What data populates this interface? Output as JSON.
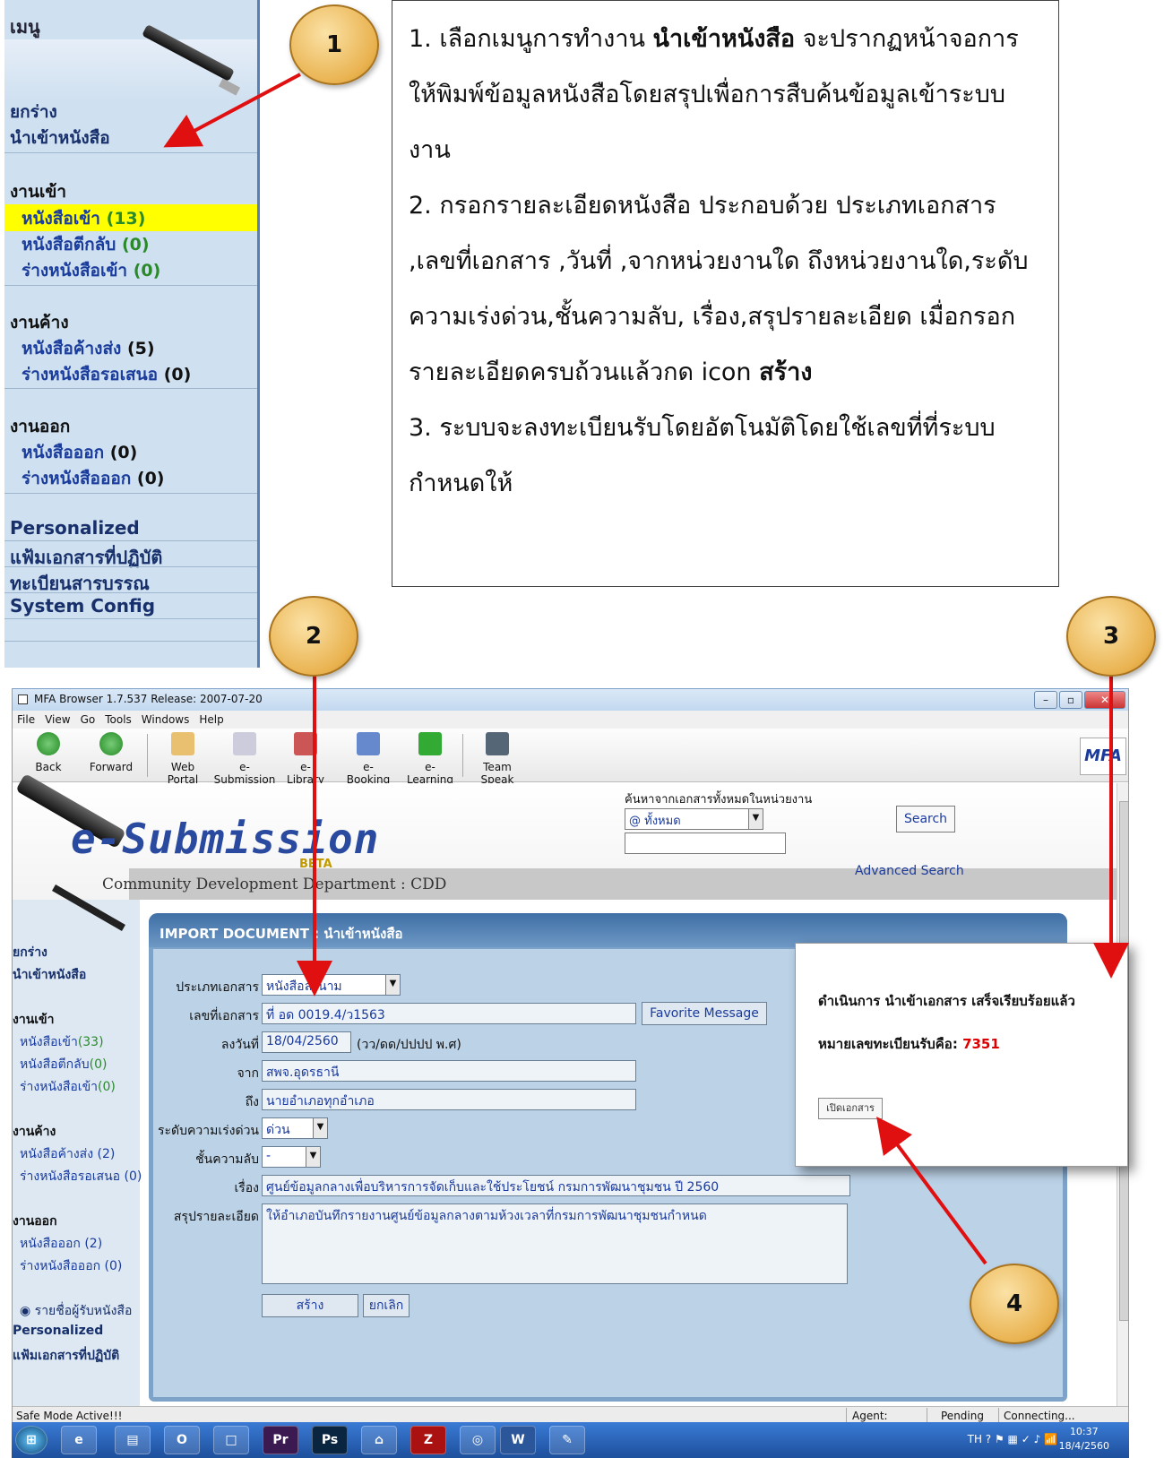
{
  "top_menu": {
    "title": "เมนู",
    "draft": "ยกร่าง",
    "import_book": "นำเข้าหนังสือ",
    "incoming_head": "งานเข้า",
    "incoming_books": "หนังสือเข้า",
    "incoming_books_count": "(13)",
    "returned_books": "หนังสือตีกลับ",
    "returned_books_count": "(0)",
    "draft_incoming": "ร่างหนังสือเข้า",
    "draft_incoming_count": "(0)",
    "pending_head": "งานค้าง",
    "pending_send": "หนังสือค้างส่ง",
    "pending_send_count": "(5)",
    "draft_propose": "ร่างหนังสือรอเสนอ",
    "draft_propose_count": "(0)",
    "outgoing_head": "งานออก",
    "outgoing_books": "หนังสือออก",
    "outgoing_books_count": "(0)",
    "draft_outgoing": "ร่างหนังสือออก",
    "draft_outgoing_count": "(0)",
    "personalized": "Personalized",
    "work_folder": "แฟ้มเอกสารที่ปฏิบัติ",
    "registry": "ทะเบียนสารบรรณ",
    "system_config": "System Config"
  },
  "instructions": {
    "p1_a": "1. เลือกเมนูการทำงาน ",
    "p1_b": "นำเข้าหนังสือ",
    "p1_c": " จะปรากฏหน้าจอการให้พิมพ์ข้อมูลหนังสือโดยสรุปเพื่อการสืบค้นข้อมูลเข้าระบบงาน",
    "p2_a": "2. กรอกรายละเอียดหนังสือ ประกอบด้วย ประเภทเอกสาร ,เลขที่เอกสาร ,วันที่ ,จากหน่วยงานใด ถึงหน่วยงานใด,ระดับความเร่งด่วน,ชั้นความลับ, เรื่อง,สรุปรายละเอียด เมื่อกรอกรายละเอียดครบถ้วนแล้วกด icon ",
    "p2_b": "สร้าง",
    "p3": "3. ระบบจะลงทะเบียนรับโดยอัตโนมัติโดยใช้เลขที่ที่ระบบกำหนดให้"
  },
  "callouts": [
    "1",
    "2",
    "3",
    "4"
  ],
  "window": {
    "title": "MFA Browser 1.7.537  Release: 2007-07-20",
    "menu": [
      "File",
      "View",
      "Go",
      "Tools",
      "Windows",
      "Help"
    ],
    "toolbar": {
      "back": "Back",
      "forward": "Forward",
      "web_portal": "Web Portal",
      "e_submission": "e-Submission",
      "e_library": "e-Library",
      "e_booking": "e-Booking",
      "e_learning": "e-Learning",
      "team_speak": "Team Speak",
      "logo": "MFA"
    }
  },
  "header": {
    "brand": "e-Submission",
    "beta": "BETA",
    "dept": "Community Development Department : CDD",
    "search_label": "ค้นหาจากเอกสารทั้งหมดในหน่วยงาน",
    "search_scope": "@ ทั้งหมด",
    "search_button": "Search",
    "advanced_search": "Advanced Search"
  },
  "app_nav": {
    "draft": "ยกร่าง",
    "import_book": "นำเข้าหนังสือ",
    "incoming_head": "งานเข้า",
    "incoming_books": "หนังสือเข้า",
    "incoming_books_count": "(33)",
    "returned_books": "หนังสือตีกลับ",
    "returned_books_count": "(0)",
    "draft_incoming": "ร่างหนังสือเข้า",
    "draft_incoming_count": "(0)",
    "pending_head": "งานค้าง",
    "pending_send": "หนังสือค้างส่ง (2)",
    "draft_propose": "ร่างหนังสือรอเสนอ (0)",
    "outgoing_head": "งานออก",
    "outgoing_books": "หนังสือออก (2)",
    "draft_outgoing": "ร่างหนังสือออก (0)",
    "recipients": "รายชื่อผู้รับหนังสือ",
    "personalized": "Personalized",
    "work_folder": "แฟ้มเอกสารที่ปฏิบัติ"
  },
  "form": {
    "panel_title": "IMPORT DOCUMENT : นำเข้าหนังสือ",
    "doc_type_label": "ประเภทเอกสาร",
    "doc_type_value": "หนังสือลงนาม",
    "doc_no_label": "เลขที่เอกสาร",
    "doc_no_value": "ที่  อด  0019.4/ว1563",
    "favorite_button": "Favorite Message",
    "date_label": "ลงวันที่",
    "date_value": "18/04/2560",
    "date_hint": "(วว/ดด/ปปปป  พ.ศ)",
    "from_label": "จาก",
    "from_value": "สพจ.อุดรธานี",
    "to_label": "ถึง",
    "to_value": "นายอำเภอทุกอำเภอ",
    "urgency_label": "ระดับความเร่งด่วน",
    "urgency_value": "ด่วน",
    "secrecy_label": "ชั้นความลับ",
    "secrecy_value": "-",
    "subject_label": "เรื่อง",
    "subject_value": "ศูนย์ข้อมูลกลางเพื่อบริหารการจัดเก็บและใช้ประโยชน์  กรมการพัฒนาชุมชน  ปี  2560",
    "summary_label": "สรุปรายละเอียด",
    "summary_value": "ให้อำเภอบันทึกรายงานศูนย์ข้อมูลกลางตามห้วงเวลาที่กรมการพัฒนาชุมชนกำหนด",
    "create_button": "สร้าง",
    "cancel_button": "ยกเลิก"
  },
  "dialog": {
    "message": "ดำเนินการ  นำเข้าเอกสาร  เสร็จเรียบร้อยแล้ว",
    "reg_label": "หมายเลขทะเบียนรับคือ:",
    "reg_number": "7351",
    "open_button": "เปิดเอกสาร"
  },
  "statusbar": {
    "safe_mode": "Safe Mode Active!!!",
    "agent": "Agent:",
    "pending": "Pending",
    "connecting": "Connecting..."
  },
  "taskbar": {
    "tray": "TH",
    "time": "10:37",
    "date": "18/4/2560"
  },
  "colors": {
    "arrow": "#e01010",
    "highlight": "#ffff00",
    "panel": "#7da3c8",
    "reg_number": "#dd0000"
  }
}
